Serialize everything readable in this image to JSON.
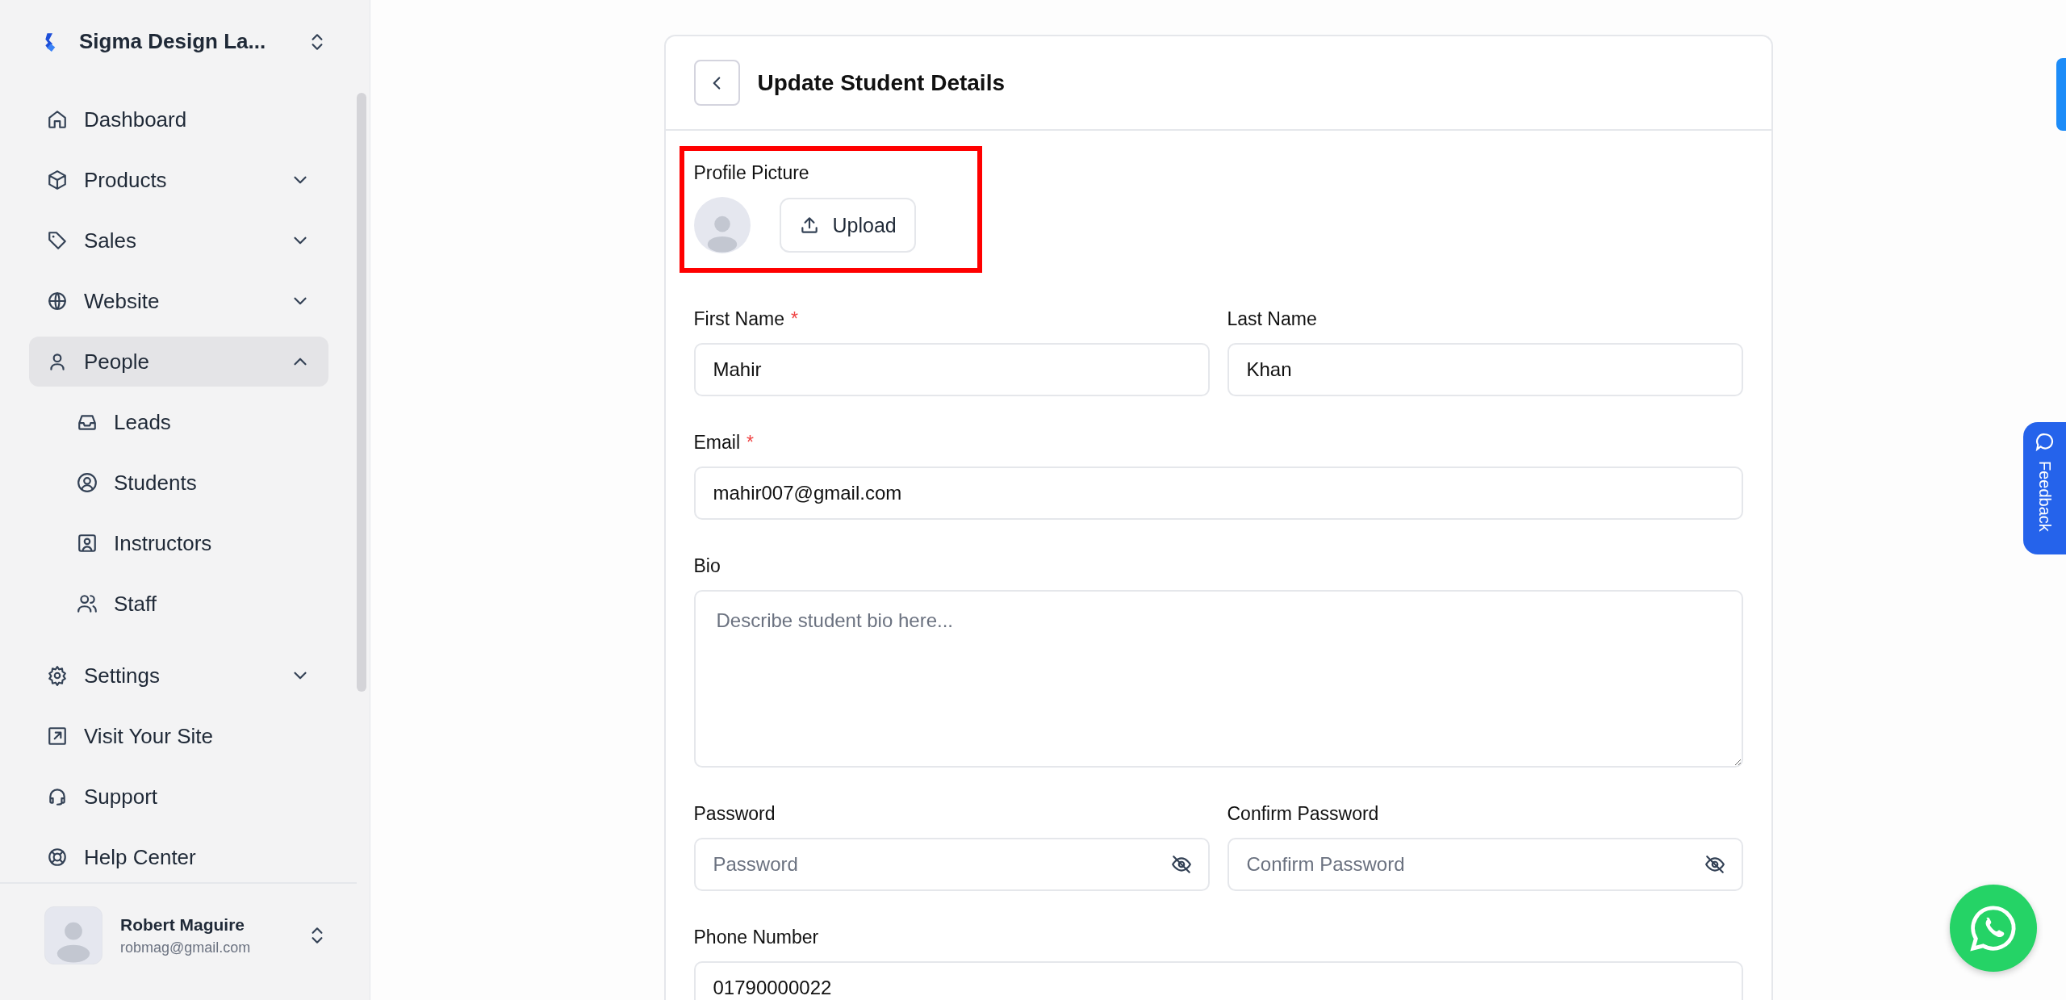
{
  "sidebar": {
    "workspace": "Sigma Design La...",
    "items": [
      {
        "label": "Dashboard"
      },
      {
        "label": "Products",
        "expanded": false
      },
      {
        "label": "Sales",
        "expanded": false
      },
      {
        "label": "Website",
        "expanded": false
      },
      {
        "label": "People",
        "expanded": true,
        "children": [
          {
            "label": "Leads"
          },
          {
            "label": "Students"
          },
          {
            "label": "Instructors"
          },
          {
            "label": "Staff"
          }
        ]
      },
      {
        "label": "Settings",
        "expanded": false
      },
      {
        "label": "Visit Your Site"
      },
      {
        "label": "Support"
      },
      {
        "label": "Help Center"
      }
    ],
    "user": {
      "name": "Robert Maguire",
      "email": "robmag@gmail.com"
    }
  },
  "form": {
    "title": "Update Student Details",
    "profile": {
      "label": "Profile Picture",
      "button": "Upload"
    },
    "rows": [
      {
        "fields": [
          {
            "kind": "text",
            "label": "First Name",
            "required_mark": "*",
            "value": "Mahir"
          },
          {
            "kind": "text",
            "label": "Last Name",
            "value": "Khan"
          }
        ]
      },
      {
        "fields": [
          {
            "kind": "text",
            "label": "Email",
            "required_mark": "*",
            "value": "mahir007@gmail.com"
          }
        ]
      },
      {
        "fields": [
          {
            "kind": "textarea",
            "label": "Bio",
            "placeholder": "Describe student bio here..."
          }
        ]
      },
      {
        "fields": [
          {
            "kind": "password",
            "label": "Password",
            "placeholder": "Password"
          },
          {
            "kind": "password",
            "label": "Confirm Password",
            "placeholder": "Confirm Password"
          }
        ]
      },
      {
        "fields": [
          {
            "kind": "text",
            "label": "Phone Number",
            "value": "01790000022"
          }
        ]
      }
    ]
  },
  "feedback_tab": {
    "label": "Feedback"
  }
}
